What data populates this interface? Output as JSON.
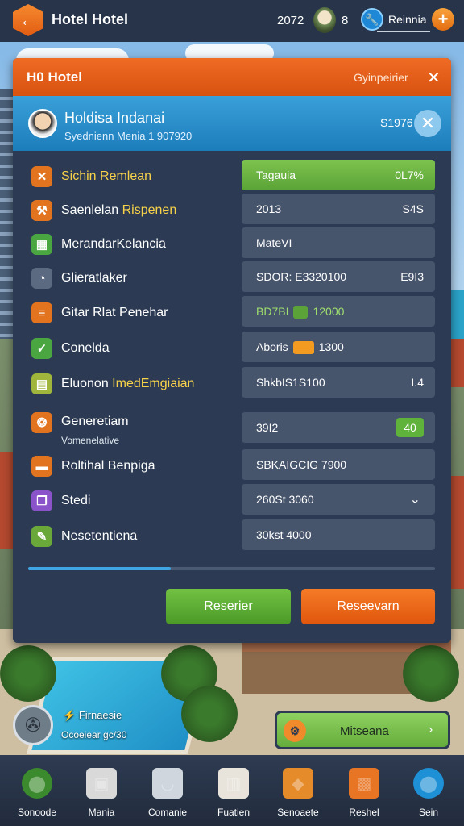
{
  "topbar": {
    "title": "Hotel Hotel",
    "stat_count": "2072",
    "stat_count2": "8",
    "resource_label": "Reinnia",
    "back_icon": "back-arrow-icon",
    "plus_icon": "plus-icon"
  },
  "panel": {
    "title": "H0 Hotel",
    "subtitle": "Gyinpeirier",
    "close_icon": "close-icon"
  },
  "guest": {
    "name": "Holdisa Indanai",
    "info": "Syednienn Menia 1 907920",
    "number": "S1976"
  },
  "rows": [
    {
      "icon": "cross-icon",
      "icon_color": "#e2741f",
      "label": "Sichin Remlean",
      "label_color": "#f8d24a",
      "value": "Tagauia",
      "value_right": "0L7%",
      "style": "green"
    },
    {
      "icon": "hammer-icon",
      "icon_color": "#e2741f",
      "label": "Saenlelan",
      "label_highlight": "Rispenen",
      "value": "2013",
      "value_right": "S4S"
    },
    {
      "icon": "chart-icon",
      "icon_color": "#4aa640",
      "label": "MerandarKelancia",
      "value": "MateVI"
    },
    {
      "icon": "clock-icon",
      "icon_color": "#5b6a80",
      "label": "Glieratlaker",
      "value": "SDOR: E3320100",
      "value_right": "E9I3"
    },
    {
      "icon": "bars-icon",
      "icon_color": "#e2741f",
      "label": "Gitar Rlat Penehar",
      "value": "BD7BI",
      "value_badge": "12000",
      "style": "greentext"
    },
    {
      "icon": "check-icon",
      "icon_color": "#4aa640",
      "label": "Conelda",
      "value": "Aboris",
      "value_badge": "1300"
    },
    {
      "icon": "document-icon",
      "icon_color": "#9fb53b",
      "label": "Eluonon",
      "label_highlight": "ImedEmgiaian",
      "value": "ShkbIS1S100",
      "value_right": "I.4"
    },
    {
      "icon": "swirl-icon",
      "icon_color": "#e2741f",
      "label": "Generetiam",
      "sublabel": "Vomenelative",
      "value": "39I2",
      "value_right": "40",
      "style": "badge"
    },
    {
      "icon": "folder-icon",
      "icon_color": "#e2741f",
      "label": "Roltihal Benpiga",
      "value": "SBKAIGCIG 7900"
    },
    {
      "icon": "book-icon",
      "icon_color": "#8b53c9",
      "label": "Stedi",
      "value": "260St 3060",
      "value_right": "⌄",
      "style": "dropdown"
    },
    {
      "icon": "pencil-icon",
      "icon_color": "#6ba83a",
      "label": "Nesetentiena",
      "value": "30kst 4000"
    }
  ],
  "progress": 0.35,
  "buttons": {
    "primary": "Reserier",
    "secondary": "Reseevarn"
  },
  "overlay": {
    "mini_title": "Firnaesie",
    "mini_sub": "Ocoeiear gc/30",
    "fan_icon": "fan-icon",
    "action_label": "Mitseana",
    "action_icon": "gear-icon",
    "action_arrow": "›"
  },
  "nav": [
    {
      "label": "Sonoode",
      "icon": "globe-icon",
      "color": "#3b8a2d"
    },
    {
      "label": "Mania",
      "icon": "box-icon",
      "color": "#d9d9d9"
    },
    {
      "label": "Comanie",
      "icon": "headset-icon",
      "color": "#cfd6dd"
    },
    {
      "label": "Fuatien",
      "icon": "scroll-icon",
      "color": "#e8e4dc"
    },
    {
      "label": "Senoaete",
      "icon": "crate-icon",
      "color": "#e58b2a"
    },
    {
      "label": "Reshel",
      "icon": "card-icon",
      "color": "#e87524"
    },
    {
      "label": "Sein",
      "icon": "chat-icon",
      "color": "#1e90d6"
    }
  ],
  "colors": {
    "accent_orange": "#e25c12",
    "accent_green": "#5aa336",
    "accent_blue": "#1c7dbb",
    "panel_bg": "#2c3b53"
  }
}
